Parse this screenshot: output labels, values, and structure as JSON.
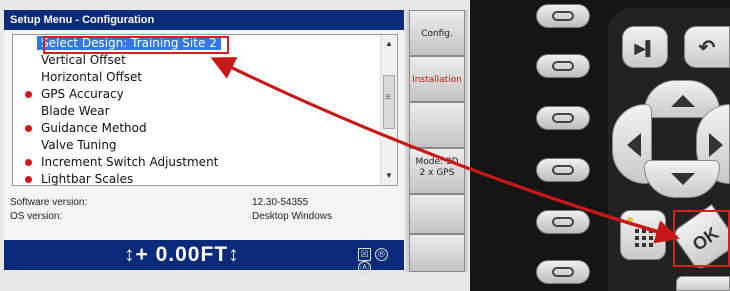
{
  "title": "Setup Menu - Configuration",
  "menu": {
    "items": [
      {
        "label": "Select Design: Training Site 2",
        "dot": false,
        "selected": true
      },
      {
        "label": "Vertical Offset",
        "dot": false
      },
      {
        "label": "Horizontal Offset",
        "dot": false
      },
      {
        "label": "GPS Accuracy",
        "dot": true
      },
      {
        "label": "Blade Wear",
        "dot": false
      },
      {
        "label": "Guidance Method",
        "dot": true
      },
      {
        "label": "Valve Tuning",
        "dot": false
      },
      {
        "label": "Increment Switch Adjustment",
        "dot": true
      },
      {
        "label": "Lightbar Scales",
        "dot": true
      }
    ]
  },
  "versions": {
    "software_label": "Software version:",
    "software_value": "12.30-54355",
    "os_label": "OS version:",
    "os_value": "Desktop Windows"
  },
  "statusbar": {
    "offset": "↕+ 0.00FT↕",
    "icons": [
      "☒",
      "®",
      "Ⓐ"
    ]
  },
  "sidebar": {
    "config": "Config.",
    "installation": "Installation",
    "mode_line1": "Mode: 3D",
    "mode_line2": "2 x GPS"
  },
  "keypad": {
    "ok_label": "OK",
    "next_icon": "▶▌",
    "undo_icon": "↶"
  },
  "colors": {
    "title_bar": "#0a2a7a",
    "selection": "#3478e5",
    "highlight_frame": "#d42020",
    "dot": "#d01818"
  }
}
